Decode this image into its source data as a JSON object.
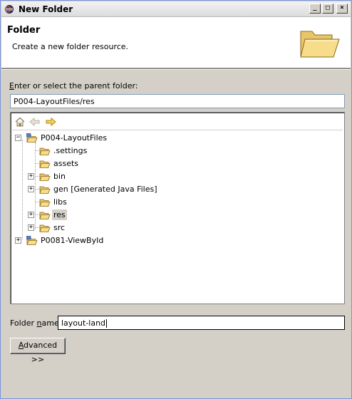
{
  "window": {
    "title": "New Folder"
  },
  "title_buttons": {
    "minimize": "_",
    "maximize": "□",
    "close": "×"
  },
  "header": {
    "title": "Folder",
    "description": "Create a new folder resource."
  },
  "parent_folder": {
    "label_prefix": "",
    "label_mnemonic": "E",
    "label_rest": "nter or select the parent folder:",
    "value": "P004-LayoutFiles/res"
  },
  "tree": {
    "toolbar": [
      "home-icon",
      "back-arrow-icon",
      "forward-arrow-icon"
    ],
    "nodes": [
      {
        "label": "P004-LayoutFiles",
        "icon": "project-icon",
        "expander": "−",
        "selected": false
      },
      {
        "label": ".settings",
        "icon": "folder-icon",
        "expander": "",
        "selected": false
      },
      {
        "label": "assets",
        "icon": "folder-icon",
        "expander": "",
        "selected": false
      },
      {
        "label": "bin",
        "icon": "folder-icon",
        "expander": "+",
        "selected": false
      },
      {
        "label": "gen [Generated Java Files]",
        "icon": "folder-icon",
        "expander": "+",
        "selected": false
      },
      {
        "label": "libs",
        "icon": "folder-icon",
        "expander": "",
        "selected": false
      },
      {
        "label": "res",
        "icon": "folder-icon",
        "expander": "+",
        "selected": true
      },
      {
        "label": "src",
        "icon": "folder-icon",
        "expander": "+",
        "selected": false
      },
      {
        "label": "P0081-ViewById",
        "icon": "project-icon",
        "expander": "+",
        "selected": false
      }
    ]
  },
  "folder_name": {
    "label_pre": "Folder ",
    "label_mnemonic": "n",
    "label_post": "ame:",
    "value": "layout-land"
  },
  "advanced_button": {
    "mnemonic": "A",
    "rest": "dvanced >>"
  }
}
